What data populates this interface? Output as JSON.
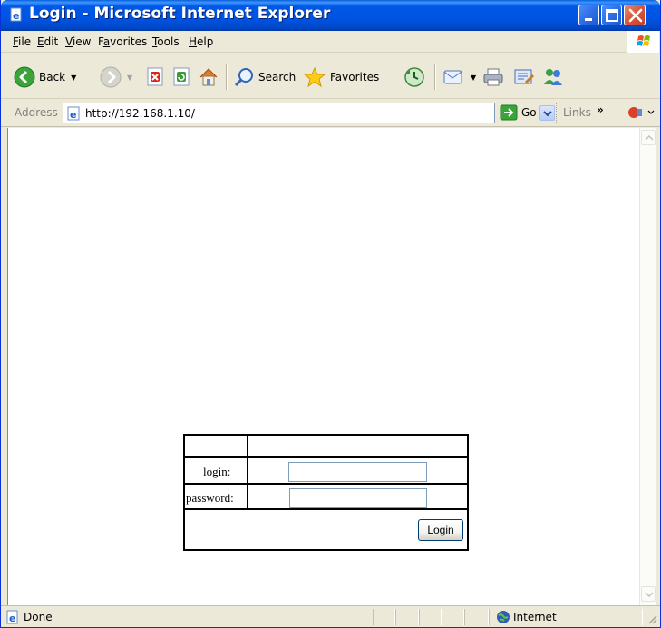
{
  "window": {
    "title": "Login - Microsoft Internet Explorer"
  },
  "menu": {
    "items": [
      "File",
      "Edit",
      "View",
      "Favorites",
      "Tools",
      "Help"
    ],
    "underline_keys": [
      "F",
      "E",
      "V",
      "a",
      "T",
      "H"
    ]
  },
  "toolbar": {
    "back_label": "Back",
    "search_label": "Search",
    "favorites_label": "Favorites"
  },
  "address": {
    "label": "Address",
    "url": "http://192.168.1.10/",
    "go_label": "Go",
    "links_label": "Links",
    "links_chevron": "»"
  },
  "login_form": {
    "login_label": "login:",
    "password_label": "password:",
    "login_value": "",
    "password_value": "",
    "submit_label": "Login"
  },
  "status": {
    "text": "Done",
    "zone": "Internet"
  },
  "colors": {
    "titlebar": "#0054e3",
    "close_button": "#d9553a",
    "chrome_bg": "#ece9d8",
    "input_border": "#7f9db9"
  }
}
